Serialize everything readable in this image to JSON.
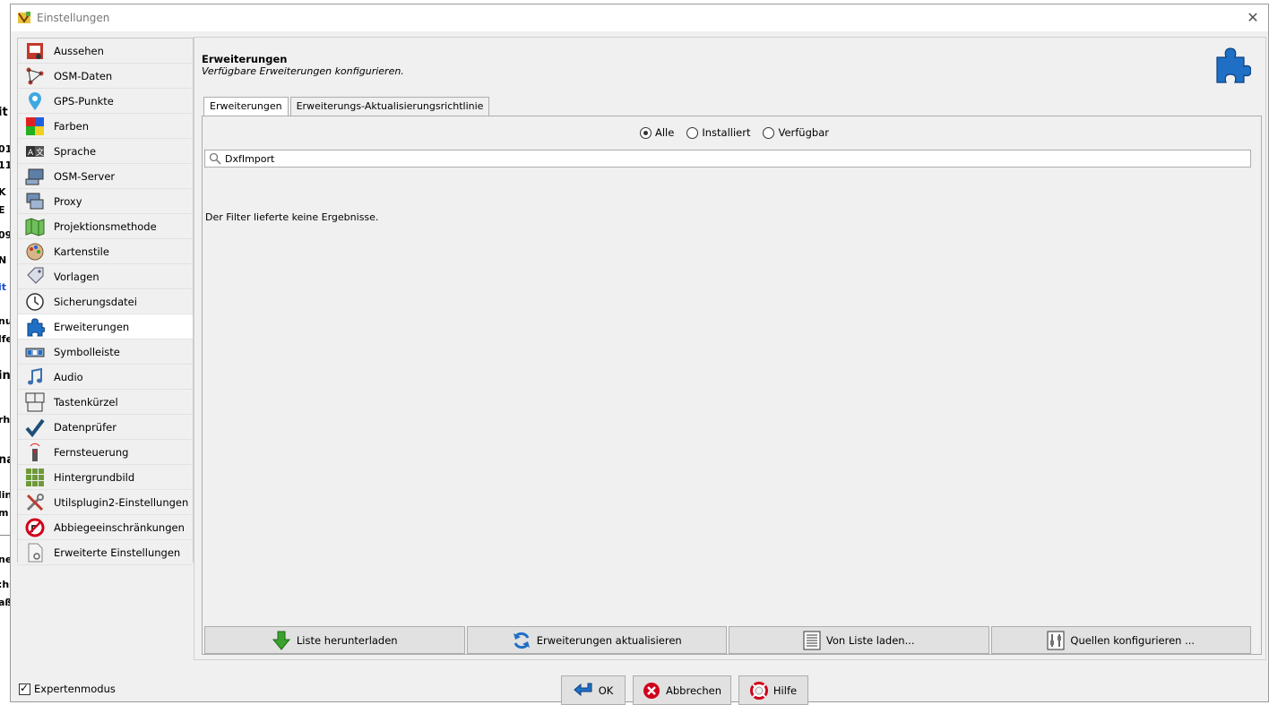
{
  "window": {
    "title": "Einstellungen"
  },
  "sidebar": {
    "items": [
      {
        "label": "Aussehen",
        "icon": "appearance-icon"
      },
      {
        "label": "OSM-Daten",
        "icon": "osm-data-icon"
      },
      {
        "label": "GPS-Punkte",
        "icon": "gps-point-icon"
      },
      {
        "label": "Farben",
        "icon": "colors-icon"
      },
      {
        "label": "Sprache",
        "icon": "language-icon"
      },
      {
        "label": "OSM-Server",
        "icon": "server-icon"
      },
      {
        "label": "Proxy",
        "icon": "proxy-icon"
      },
      {
        "label": "Projektionsmethode",
        "icon": "projection-icon"
      },
      {
        "label": "Kartenstile",
        "icon": "map-style-icon"
      },
      {
        "label": "Vorlagen",
        "icon": "presets-icon"
      },
      {
        "label": "Sicherungsdatei",
        "icon": "backup-icon"
      },
      {
        "label": "Erweiterungen",
        "icon": "plugin-icon",
        "active": true
      },
      {
        "label": "Symbolleiste",
        "icon": "toolbar-icon"
      },
      {
        "label": "Audio",
        "icon": "audio-icon"
      },
      {
        "label": "Tastenkürzel",
        "icon": "shortcut-icon"
      },
      {
        "label": "Datenprüfer",
        "icon": "validator-icon"
      },
      {
        "label": "Fernsteuerung",
        "icon": "remote-control-icon"
      },
      {
        "label": "Hintergrundbild",
        "icon": "imagery-icon"
      },
      {
        "label": "Utilsplugin2-Einstellungen",
        "icon": "tools-icon"
      },
      {
        "label": "Abbiegeeinschränkungen",
        "icon": "turn-restriction-icon"
      },
      {
        "label": "Erweiterte Einstellungen",
        "icon": "advanced-icon"
      }
    ]
  },
  "header": {
    "title": "Erweiterungen",
    "subtitle": "Verfügbare Erweiterungen konfigurieren."
  },
  "tabs": [
    {
      "label": "Erweiterungen",
      "active": true
    },
    {
      "label": "Erweiterungs-Aktualisierungsrichtlinie",
      "active": false
    }
  ],
  "filter": {
    "options": [
      {
        "label": "Alle",
        "selected": true
      },
      {
        "label": "Installiert",
        "selected": false
      },
      {
        "label": "Verfügbar",
        "selected": false
      }
    ],
    "search_value": "DxfImport"
  },
  "empty_message": "Der Filter lieferte keine Ergebnisse.",
  "actions": {
    "download": "Liste herunterladen",
    "update": "Erweiterungen aktualisieren",
    "load": "Von Liste laden...",
    "sources": "Quellen konfigurieren ..."
  },
  "footer": {
    "expert_mode": "Expertenmodus",
    "expert_checked": true,
    "ok": "OK",
    "cancel": "Abbrechen",
    "help": "Hilfe"
  },
  "colors": {
    "accent_blue": "#1f6fc5",
    "download_green": "#3aa12e",
    "cancel_red": "#d0021b"
  }
}
